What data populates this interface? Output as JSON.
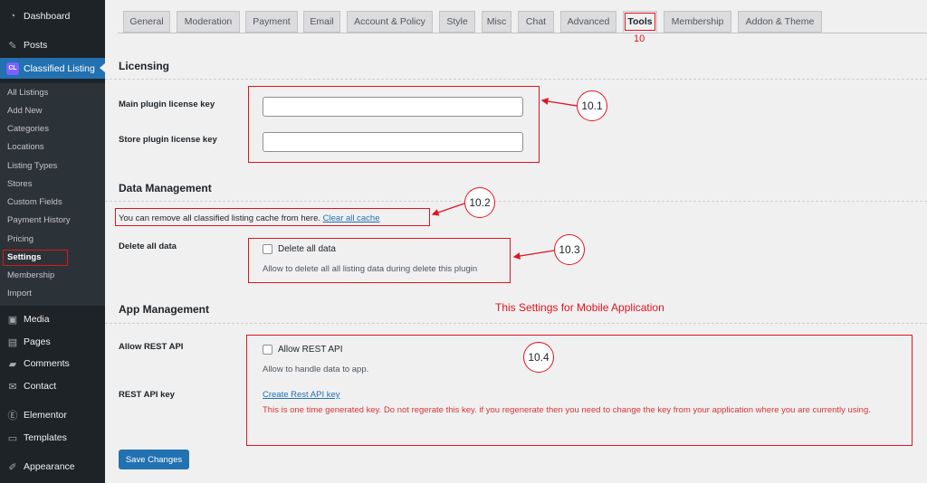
{
  "sidebar": {
    "top_items": [
      {
        "label": "Dashboard",
        "icon": "dashboard-icon"
      },
      {
        "label": "Posts",
        "icon": "pin-icon"
      },
      {
        "label": "Classified Listing",
        "icon": "classified-listing-logo-icon"
      }
    ],
    "submenu": [
      "All Listings",
      "Add New",
      "Categories",
      "Locations",
      "Listing Types",
      "Stores",
      "Custom Fields",
      "Payment History",
      "Pricing",
      "Settings",
      "Membership",
      "Import"
    ],
    "bottom_items": [
      {
        "label": "Media",
        "icon": "media-icon"
      },
      {
        "label": "Pages",
        "icon": "pages-icon"
      },
      {
        "label": "Comments",
        "icon": "comment-icon"
      },
      {
        "label": "Contact",
        "icon": "mail-icon"
      },
      {
        "label": "Elementor",
        "icon": "elementor-icon"
      },
      {
        "label": "Templates",
        "icon": "folder-icon"
      },
      {
        "label": "Appearance",
        "icon": "brush-icon"
      }
    ],
    "logo_text": "CL"
  },
  "tabs": [
    "General",
    "Moderation",
    "Payment",
    "Email",
    "Account & Policy",
    "Style",
    "Misc",
    "Chat",
    "Advanced",
    "Tools",
    "Membership",
    "Addon & Theme"
  ],
  "annotations": {
    "tools_number": "10",
    "licensing_number": "10.1",
    "data_number": "10.2",
    "delete_number": "10.3",
    "app_number": "10.4",
    "mobile_note": "This Settings for Mobile Application"
  },
  "licensing": {
    "title": "Licensing",
    "main_label": "Main plugin license key",
    "main_value": "",
    "store_label": "Store plugin license key",
    "store_value": ""
  },
  "data_management": {
    "title": "Data Management",
    "cache_text": "You can remove all classified listing cache from here.",
    "cache_link": "Clear all cache",
    "delete_label": "Delete all data",
    "delete_checkbox": "Delete all data",
    "delete_desc": "Allow to delete all all listing data during delete this plugin"
  },
  "app_management": {
    "title": "App Management",
    "rest_label": "Allow REST API",
    "rest_checkbox": "Allow REST API",
    "rest_desc": "Allow to handle data to app.",
    "key_label": "REST API key",
    "key_link": "Create Rest API key",
    "key_warning": "This is one time generated key. Do not regerate this key. if you regenerate then you need to change the key from your application where you are currently using."
  },
  "save_button": "Save Changes",
  "colors": {
    "accent": "#2271b1",
    "annotation_red": "#e0141e",
    "sidebar_bg": "#1d2327"
  }
}
